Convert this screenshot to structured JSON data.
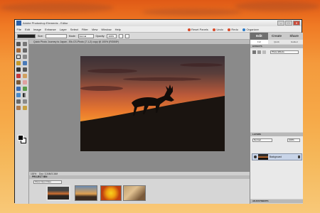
{
  "window": {
    "title": "Adobe Photoshop Elements - Editor",
    "controls": [
      "–",
      "□",
      "✕"
    ]
  },
  "menu": [
    "File",
    "Edit",
    "Image",
    "Enhance",
    "Layer",
    "Select",
    "Filter",
    "View",
    "Window",
    "Help"
  ],
  "top_actions": [
    {
      "label": "Reset Panels",
      "icon": "reset-panels-icon",
      "color": "#d94a2a"
    },
    {
      "label": "Undo",
      "icon": "undo-icon",
      "color": "#d94a2a"
    },
    {
      "label": "Redo",
      "icon": "redo-icon",
      "color": "#d94a2a"
    },
    {
      "label": "Organizer",
      "icon": "organizer-icon",
      "color": "#d94a2a"
    }
  ],
  "options": {
    "size_label": "Size:",
    "size_value": "100%",
    "mode_label": "Mode:",
    "mode_value": "Normal",
    "opacity_label": "Opacity:",
    "opacity_value": "100%"
  },
  "document": {
    "tab_title": "Quick Photo Journey to Japan - Elk.CS-Photo (7.1-2) copy @ 100% (RGB/8*)",
    "zoom": "100%",
    "doc_size": "Doc: 3.34M/3.34M"
  },
  "project_bin": {
    "header": "PROJECT BIN",
    "dropdown": "Show Open Files"
  },
  "panels": {
    "tabs": [
      "Edit",
      "Create",
      "Share"
    ],
    "subtabs": [
      "Full",
      "Quick",
      "Guided"
    ],
    "effects_header": "EFFECTS",
    "effects_dropdown": "Photo Effects",
    "layers_header": "LAYERS",
    "layer_mode": "Normal",
    "layer_opacity": "100%",
    "layer_name": "Background",
    "adjustments_header": "ADJUSTMENTS"
  },
  "colors": {
    "accent": "#6f6f6f",
    "sunset_top": "#3b3036",
    "sunset_mid": "#e9782e",
    "ground": "#1a1410"
  }
}
